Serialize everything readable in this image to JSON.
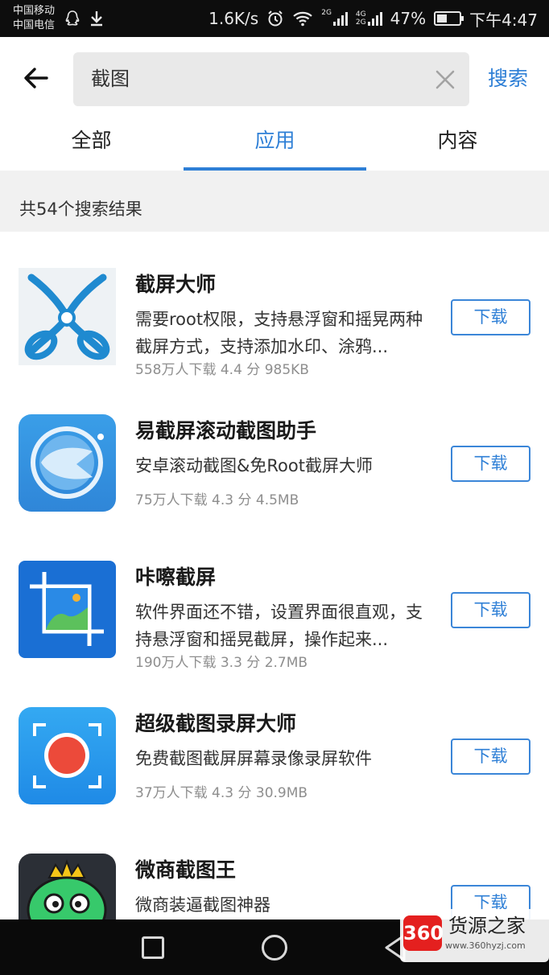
{
  "status_bar": {
    "carrier_1": "中国移动",
    "carrier_2": "中国电信",
    "speed": "1.6K/s",
    "net1": "2G",
    "net2": "4G",
    "net3": "2G",
    "battery": "47%",
    "time": "下午4:47"
  },
  "search": {
    "query": "截图",
    "button_label": "搜索"
  },
  "tabs": [
    {
      "label": "全部"
    },
    {
      "label": "应用"
    },
    {
      "label": "内容"
    }
  ],
  "active_tab": "应用",
  "result_count_text": "共54个搜索结果",
  "apps": [
    {
      "name": "截屏大师",
      "desc": "需要root权限，支持悬浮窗和摇晃两种截屏方式，支持添加水印、涂鸦...",
      "meta": "558万人下载  4.4 分   985KB",
      "button": "下载"
    },
    {
      "name": "易截屏滚动截图助手",
      "desc": "安卓滚动截图&免Root截屏大师",
      "meta": "75万人下载  4.3 分   4.5MB",
      "button": "下载"
    },
    {
      "name": "咔嚓截屏",
      "desc": "软件界面还不错，设置界面很直观，支持悬浮窗和摇晃截屏，操作起来...",
      "meta": "190万人下载  3.3 分   2.7MB",
      "button": "下载"
    },
    {
      "name": "超级截图录屏大师",
      "desc": "免费截图截屏屏幕录像录屏软件",
      "meta": "37万人下载  4.3 分   30.9MB",
      "button": "下载"
    },
    {
      "name": "微商截图王",
      "desc": "微商装逼截图神器",
      "meta": "",
      "button": "下载"
    }
  ],
  "watermark": {
    "logo_text": "360",
    "title": "货源之家",
    "url": "www.360hyzj.com"
  },
  "colors": {
    "accent": "#2e7fd6",
    "status_bar_bg": "#0d0d0d",
    "count_bar_bg": "#f1f1f1",
    "search_box_bg": "#e9e9e9"
  }
}
